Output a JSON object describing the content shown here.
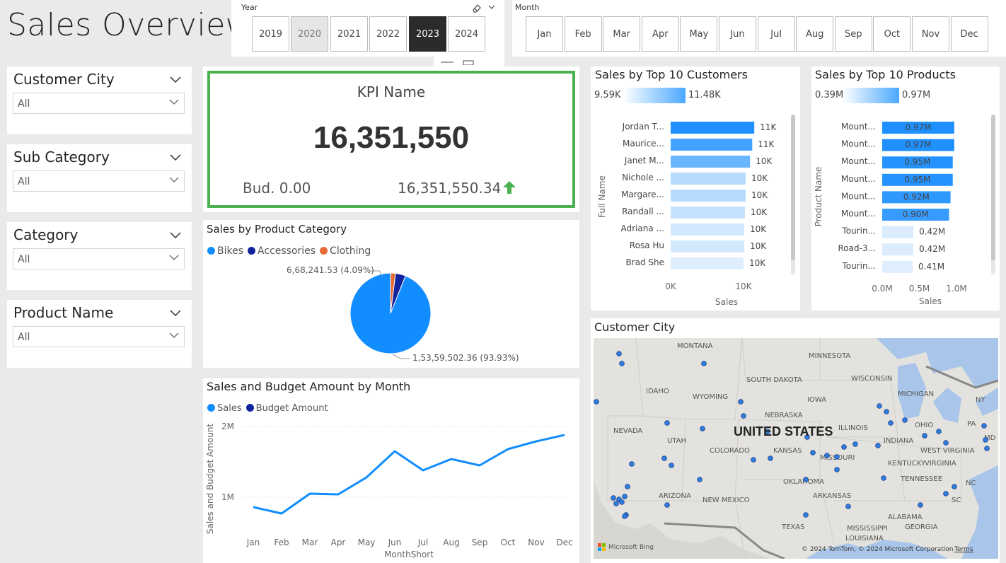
{
  "page": {
    "title": "Sales Overview"
  },
  "year_slicer": {
    "label": "Year",
    "years": [
      "2019",
      "2020",
      "2021",
      "2022",
      "2023",
      "2024"
    ],
    "selected": "2023"
  },
  "month_slicer": {
    "label": "Month",
    "months": [
      "Jan",
      "Feb",
      "Mar",
      "Apr",
      "May",
      "Jun",
      "Jul",
      "Aug",
      "Sep",
      "Oct",
      "Nov",
      "Dec"
    ]
  },
  "filters": [
    {
      "label": "Customer City",
      "value": "All"
    },
    {
      "label": "Sub Category",
      "value": "All"
    },
    {
      "label": "Category",
      "value": "All"
    },
    {
      "label": "Product Name",
      "value": "All"
    }
  ],
  "kpi": {
    "name": "KPI Name",
    "value": "16,351,550",
    "budget": "Bud. 0.00",
    "actual": "16,351,550.34",
    "accent": "#4caf50",
    "trend_color": "#4caf50"
  },
  "pie": {
    "title": "Sales by Product Category",
    "legend": [
      "Bikes",
      "Accessories",
      "Clothing"
    ],
    "label_small": "6,68,241.53 (4.09%)",
    "label_large": "1,53,59,502.36 (93.93%)"
  },
  "customers_chart": {
    "title": "Sales by Top 10 Customers",
    "scale_min": "9.59K",
    "scale_max": "11.48K",
    "ylabel": "Full Name",
    "xlabel": "Sales",
    "ticks": [
      "0K",
      "10K"
    ]
  },
  "products_chart": {
    "title": "Sales by Top 10 Products",
    "scale_min": "0.39M",
    "scale_max": "0.97M",
    "ylabel": "Product Name",
    "xlabel": "Sales",
    "ticks": [
      "0.0M",
      "0.5M",
      "1.0M"
    ]
  },
  "line_chart": {
    "title": "Sales and Budget Amount by Month",
    "legend": [
      "Sales",
      "Budget Amount"
    ],
    "ylabel": "Sales and Budget Amount",
    "xlabel": "MonthShort",
    "yticks": [
      "2M",
      "1M"
    ]
  },
  "map": {
    "title": "Customer City",
    "country_label": "UNITED STATES",
    "states": [
      "MONTANA",
      "MINNESOTA",
      "WISCONSIN",
      "SOUTH DAKOTA",
      "MICHIGAN",
      "IDAHO",
      "WYOMING",
      "IOWA",
      "NEBRASKA",
      "NY",
      "NEVADA",
      "UTAH",
      "ILLINOIS",
      "OHIO",
      "PA",
      "COLORADO",
      "KANSAS",
      "INDIANA",
      "WEST VIRGINIA",
      "MD",
      "MISSOURI",
      "KENTUCKY",
      "VIRGINIA",
      "OKLAHOMA",
      "TENNESSEE",
      "NC",
      "ARIZONA",
      "NEW MEXICO",
      "ARKANSAS",
      "SC",
      "ALABAMA",
      "TEXAS",
      "MISSISSIPPI",
      "GEORGIA",
      "LOUISIANA"
    ],
    "brand": "Microsoft Bing",
    "copyright": "© 2024 TomTom, © 2024 Microsoft Corporation",
    "terms": "Terms"
  },
  "chart_data": [
    {
      "type": "bar",
      "title": "Sales by Top 10 Customers",
      "xlabel": "Sales",
      "ylabel": "Full Name",
      "categories": [
        "Jordan T...",
        "Maurice...",
        "Janet M...",
        "Nichole ...",
        "Margare...",
        "Randall ...",
        "Adriana ...",
        "Rosa Hu",
        "Brad She"
      ],
      "values": [
        11.48,
        11.2,
        10.9,
        10.3,
        10.3,
        10.2,
        10.1,
        10.1,
        10.0
      ],
      "labels": [
        "11K",
        "11K",
        "10K",
        "10K",
        "10K",
        "10K",
        "10K",
        "10K",
        "10K"
      ],
      "xlim": [
        0,
        12
      ],
      "units": "K"
    },
    {
      "type": "bar",
      "title": "Sales by Top 10 Products",
      "xlabel": "Sales",
      "ylabel": "Product Name",
      "categories": [
        "Mount...",
        "Mount...",
        "Mount...",
        "Mount...",
        "Mount...",
        "Mount...",
        "Tourin...",
        "Road-3...",
        "Tourin..."
      ],
      "values": [
        0.97,
        0.97,
        0.95,
        0.95,
        0.92,
        0.9,
        0.42,
        0.42,
        0.41
      ],
      "labels": [
        "0.97M",
        "0.97M",
        "0.95M",
        "0.95M",
        "0.92M",
        "0.90M",
        "0.42M",
        "0.42M",
        "0.41M"
      ],
      "xlim": [
        0,
        1.0
      ],
      "units": "M"
    },
    {
      "type": "pie",
      "title": "Sales by Product Category",
      "categories": [
        "Bikes",
        "Accessories",
        "Clothing"
      ],
      "values": [
        15359502.36,
        668241.53,
        323806.45
      ],
      "colors": [
        "#118dff",
        "#12239e",
        "#e66c37"
      ]
    },
    {
      "type": "line",
      "title": "Sales and Budget Amount by Month",
      "xlabel": "MonthShort",
      "ylabel": "Sales and Budget Amount",
      "categories": [
        "Jan",
        "Feb",
        "Mar",
        "Apr",
        "May",
        "Jun",
        "Jul",
        "Aug",
        "Sep",
        "Oct",
        "Nov",
        "Dec"
      ],
      "series": [
        {
          "name": "Sales",
          "color": "#118dff",
          "values": [
            0.86,
            0.77,
            1.05,
            1.04,
            1.28,
            1.65,
            1.38,
            1.54,
            1.45,
            1.68,
            1.79,
            1.88
          ]
        },
        {
          "name": "Budget Amount",
          "color": "#12239e",
          "values": []
        }
      ],
      "ylim": [
        0.6,
        2.05
      ],
      "units": "M"
    }
  ]
}
